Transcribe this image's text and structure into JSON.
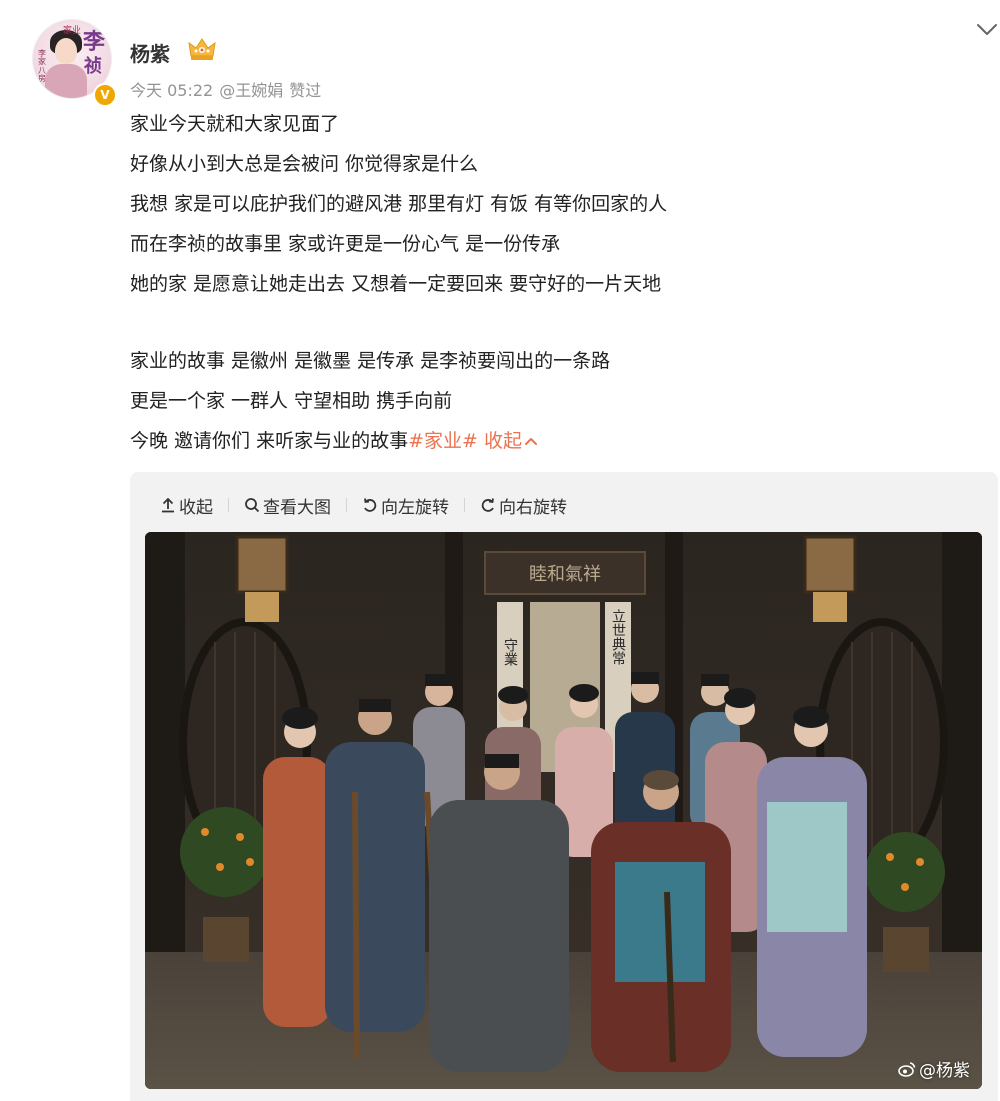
{
  "post": {
    "author": {
      "name": "杨紫",
      "avatar_text": {
        "top": "家业",
        "main1": "李",
        "main2": "祯",
        "side": "李家八房"
      },
      "verified_badge": "V"
    },
    "meta": {
      "time": "今天 05:22",
      "mention": "@王婉娟",
      "liked_label": "赞过"
    },
    "lines": [
      "家业今天就和大家见面了",
      "好像从小到大总是会被问 你觉得家是什么",
      "我想 家是可以庇护我们的避风港 那里有灯 有饭 有等你回家的人",
      "而在李祯的故事里 家或许更是一份心气 是一份传承",
      "她的家 是愿意让她走出去 又想着一定要回来 要守好的一片天地",
      "",
      "家业的故事 是徽州 是徽墨 是传承 是李祯要闯出的一条路",
      "更是一个家 一群人 守望相助 携手向前"
    ],
    "last_line": {
      "text": "今晚 邀请你们 来听家与业的故事",
      "hashtag": "#家业#",
      "collapse": " 收起"
    }
  },
  "media": {
    "toolbar": {
      "collapse": "收起",
      "view_large": "查看大图",
      "rotate_left": "向左旋转",
      "rotate_right": "向右旋转"
    },
    "watermark": "@杨紫",
    "signboard": "睦和氣祥",
    "couplet_left": "守業",
    "couplet_right": "立世典常"
  },
  "colors": {
    "accent": "#eb7350",
    "meta_gray": "#939393",
    "badge": "#f0a800",
    "card_bg": "#f2f2f2"
  }
}
